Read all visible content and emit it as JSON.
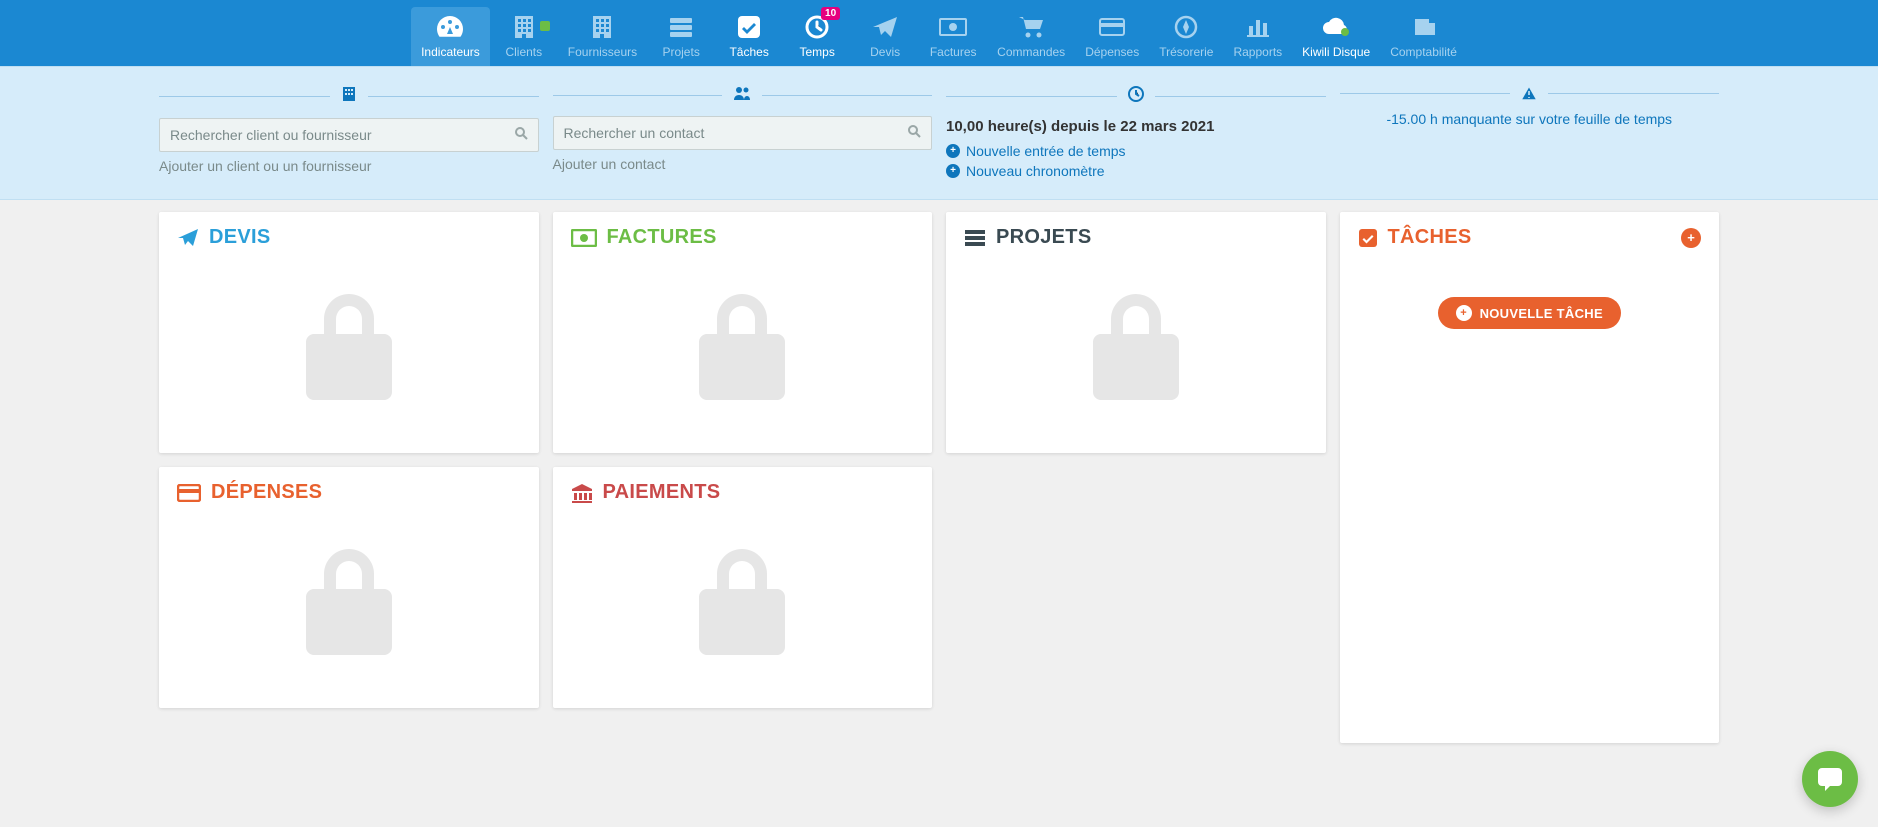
{
  "nav": {
    "items": [
      {
        "label": "Indicateurs",
        "icon": "gauge-icon",
        "active": true
      },
      {
        "label": "Clients",
        "icon": "building-icon",
        "accent": true
      },
      {
        "label": "Fournisseurs",
        "icon": "building-icon"
      },
      {
        "label": "Projets",
        "icon": "projects-icon"
      },
      {
        "label": "Tâches",
        "icon": "check-icon",
        "highlight": true
      },
      {
        "label": "Temps",
        "icon": "clock-icon",
        "highlight": true,
        "badge": "10"
      },
      {
        "label": "Devis",
        "icon": "send-icon"
      },
      {
        "label": "Factures",
        "icon": "money-icon"
      },
      {
        "label": "Commandes",
        "icon": "cart-icon"
      },
      {
        "label": "Dépenses",
        "icon": "card-icon"
      },
      {
        "label": "Trésorerie",
        "icon": "compass-icon"
      },
      {
        "label": "Rapports",
        "icon": "chart-icon"
      },
      {
        "label": "Kiwili Disque",
        "icon": "cloud-icon",
        "highlight": true
      },
      {
        "label": "Comptabilité",
        "icon": "accounting-icon"
      }
    ]
  },
  "search": {
    "client_placeholder": "Rechercher client ou fournisseur",
    "add_client": "Ajouter un client ou un fournisseur",
    "contact_placeholder": "Rechercher un contact",
    "add_contact": "Ajouter un contact"
  },
  "time": {
    "summary": "10,00 heure(s) depuis le 22 mars 2021",
    "new_entry": "Nouvelle entrée de temps",
    "new_timer": "Nouveau chronomètre"
  },
  "warning": {
    "text": "-15.00 h manquante sur votre feuille de temps"
  },
  "cards": {
    "devis": "DEVIS",
    "factures": "FACTURES",
    "projets": "PROJETS",
    "taches": "TÂCHES",
    "depenses": "DÉPENSES",
    "paiements": "PAIEMENTS",
    "new_task": "NOUVELLE TÂCHE"
  }
}
